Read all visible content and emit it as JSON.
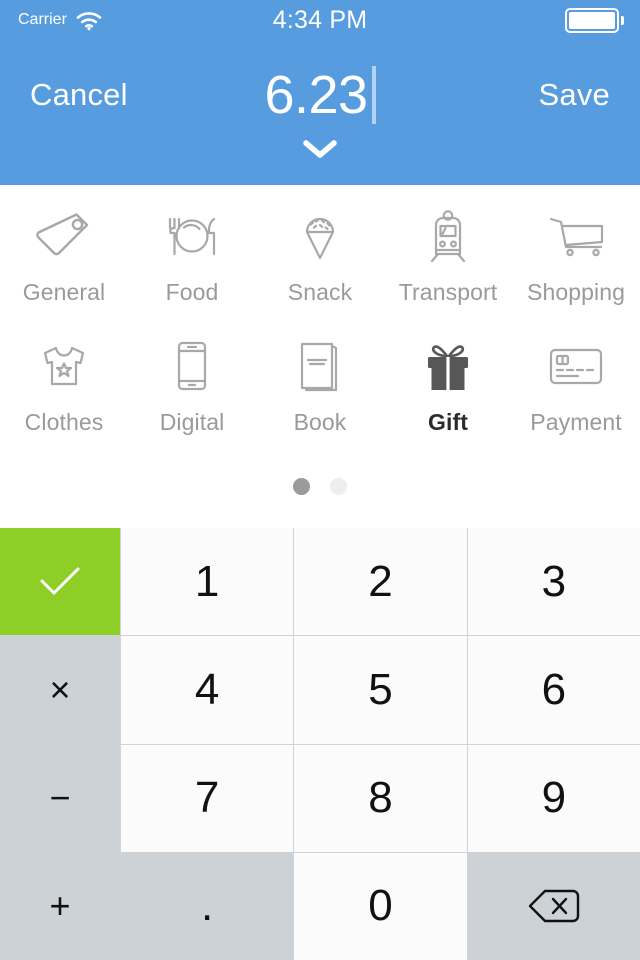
{
  "status_bar": {
    "carrier": "Carrier",
    "wifi_icon": "wifi-icon",
    "time": "4:34 PM",
    "battery_icon": "battery-full-icon"
  },
  "nav_bar": {
    "cancel_label": "Cancel",
    "save_label": "Save",
    "amount_value": "6.23",
    "collapse_icon": "chevron-down-icon"
  },
  "categories": {
    "selected": "Gift",
    "page_dots": {
      "count": 2,
      "active_index": 0
    },
    "items": [
      {
        "label": "General",
        "icon": "tag-icon",
        "selected": false
      },
      {
        "label": "Food",
        "icon": "cutlery-plate-icon",
        "selected": false
      },
      {
        "label": "Snack",
        "icon": "ice-cream-icon",
        "selected": false
      },
      {
        "label": "Transport",
        "icon": "train-icon",
        "selected": false
      },
      {
        "label": "Shopping",
        "icon": "shopping-cart-icon",
        "selected": false
      },
      {
        "label": "Clothes",
        "icon": "tshirt-icon",
        "selected": false
      },
      {
        "label": "Digital",
        "icon": "smartphone-icon",
        "selected": false
      },
      {
        "label": "Book",
        "icon": "book-icon",
        "selected": false
      },
      {
        "label": "Gift",
        "icon": "gift-icon",
        "selected": true
      },
      {
        "label": "Payment",
        "icon": "credit-card-icon",
        "selected": false
      }
    ]
  },
  "keypad": {
    "confirm_icon": "checkmark-icon",
    "backspace_icon": "backspace-icon",
    "keys": {
      "multiply": "×",
      "minus": "−",
      "plus": "+",
      "decimal": ".",
      "one": "1",
      "two": "2",
      "three": "3",
      "four": "4",
      "five": "5",
      "six": "6",
      "seven": "7",
      "eight": "8",
      "nine": "9",
      "zero": "0"
    }
  },
  "colors": {
    "header_blue": "#589CE0",
    "confirm_green": "#8DCE27",
    "function_key_gray": "#CDD2D7",
    "number_key_white": "#FBFBFB",
    "label_gray": "#9A9A9A",
    "selected_label": "#2B2B2B"
  }
}
